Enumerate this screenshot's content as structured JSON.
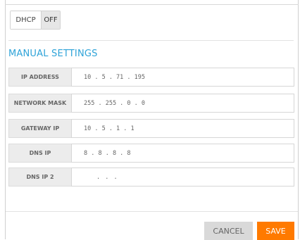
{
  "toggle": {
    "label": "DHCP",
    "state": "OFF"
  },
  "section_title": "MANUAL SETTINGS",
  "fields": [
    {
      "label": "IP ADDRESS",
      "value": "10 . 5 . 71 . 195"
    },
    {
      "label": "NETWORK MASK",
      "value": "255 . 255 . 0 . 0"
    },
    {
      "label": "GATEWAY IP",
      "value": "10 . 5 . 1 . 1"
    },
    {
      "label": "DNS IP",
      "value": "8 . 8 . 8 . 8"
    },
    {
      "label": "DNS IP 2",
      "value": ". . ."
    }
  ],
  "buttons": {
    "cancel": "CANCEL",
    "save": "SAVE"
  },
  "colors": {
    "accent": "#2ea3d8",
    "save": "#ff7a00",
    "cancel": "#d9d9d9"
  }
}
